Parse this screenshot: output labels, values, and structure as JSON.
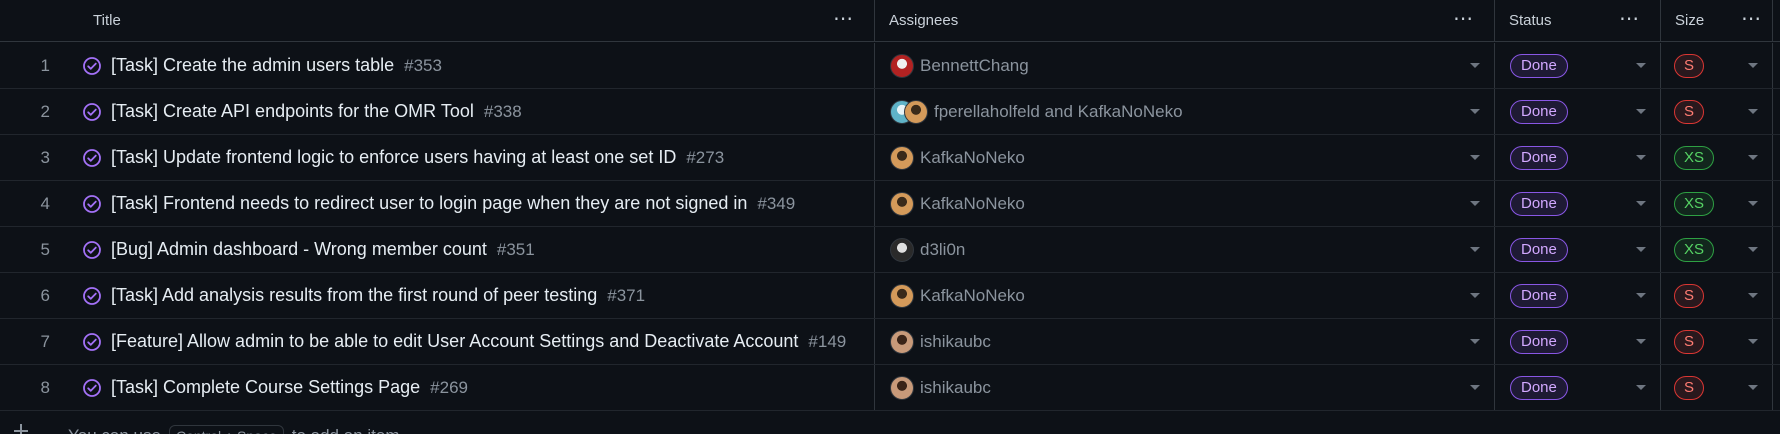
{
  "header": {
    "title": "Title",
    "assignees": "Assignees",
    "status": "Status",
    "size": "Size",
    "menu_glyph": "⋯"
  },
  "colors": {
    "background": "#0d1117",
    "done_purple": "#a371f7",
    "size_s_red": "#ff7b72",
    "size_xs_green": "#56d364"
  },
  "rows": [
    {
      "num": "1",
      "title": "[Task] Create the admin users table",
      "issue": "#353",
      "assignees": "BennettChang",
      "status": "Done",
      "size": "S"
    },
    {
      "num": "2",
      "title": "[Task] Create API endpoints for the OMR Tool",
      "issue": "#338",
      "assignees": "fperellaholfeld and KafkaNoNeko",
      "status": "Done",
      "size": "S"
    },
    {
      "num": "3",
      "title": "[Task] Update frontend logic to enforce users having at least one set ID",
      "issue": "#273",
      "assignees": "KafkaNoNeko",
      "status": "Done",
      "size": "XS"
    },
    {
      "num": "4",
      "title": "[Task] Frontend needs to redirect user to login page when they are not signed in",
      "issue": "#349",
      "assignees": "KafkaNoNeko",
      "status": "Done",
      "size": "XS"
    },
    {
      "num": "5",
      "title": "[Bug] Admin dashboard - Wrong member count",
      "issue": "#351",
      "assignees": "d3li0n",
      "status": "Done",
      "size": "XS"
    },
    {
      "num": "6",
      "title": "[Task] Add analysis results from the first round of peer testing",
      "issue": "#371",
      "assignees": "KafkaNoNeko",
      "status": "Done",
      "size": "S"
    },
    {
      "num": "7",
      "title": "[Feature] Allow admin to be able to edit User Account Settings and Deactivate Account",
      "issue": "#149",
      "assignees": "ishikaubc",
      "status": "Done",
      "size": "S"
    },
    {
      "num": "8",
      "title": "[Task] Complete Course Settings Page",
      "issue": "#269",
      "assignees": "ishikaubc",
      "status": "Done",
      "size": "S"
    }
  ],
  "footer": {
    "prefix": "You can use",
    "shortcut": "Control + Space",
    "suffix": "to add an item"
  }
}
